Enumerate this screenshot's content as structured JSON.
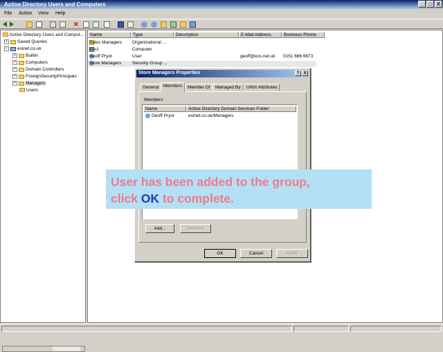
{
  "window": {
    "title": "Active Directory Users and Computers"
  },
  "menu": [
    "File",
    "Action",
    "View",
    "Help"
  ],
  "tree": {
    "root": "Active Directory Users and Comput...",
    "saved_queries": "Saved Queries",
    "domain": "esinet.co.uk",
    "children": [
      "Builtin",
      "Computers",
      "Domain Controllers",
      "ForeignSecurityPrincipals",
      "Managers",
      "Users"
    ]
  },
  "list": {
    "columns": [
      "Name",
      "Type",
      "Description",
      "E-Mail Address",
      "Business Phone"
    ],
    "rows": [
      [
        "Sales Managers",
        "Organizational ...",
        "",
        "",
        ""
      ],
      [
        "ecs1",
        "Computer",
        "",
        "",
        ""
      ],
      [
        "Geoff Pryor",
        "User",
        "",
        "geoff@ecs.net.uk",
        "0151 666 6673"
      ],
      [
        "Store Managers",
        "Security Group ...",
        "",
        "",
        ""
      ]
    ]
  },
  "dialog": {
    "title": "Store Managers Properties",
    "help_btn": "?",
    "close_btn": "X",
    "tabs": [
      "General",
      "Members",
      "Member Of",
      "Managed By",
      "UNIX Attributes"
    ],
    "members_label": "Members:",
    "columns": [
      "Name",
      "Active Directory Domain Services Folder"
    ],
    "members": [
      [
        "Geoff Pryor",
        "esinet.co.uk/Managers"
      ]
    ],
    "add_btn": "Add...",
    "remove_btn": "Remove",
    "ok_btn": "OK",
    "cancel_btn": "Cancel",
    "apply_btn": "Apply"
  },
  "callout": {
    "line1": "User has been added to the group,",
    "line2_pre": "click ",
    "line2_ok": "OK",
    "line2_post": " to complete."
  },
  "window_controls": {
    "minimize": "_",
    "maximize": "□",
    "close": "X"
  }
}
